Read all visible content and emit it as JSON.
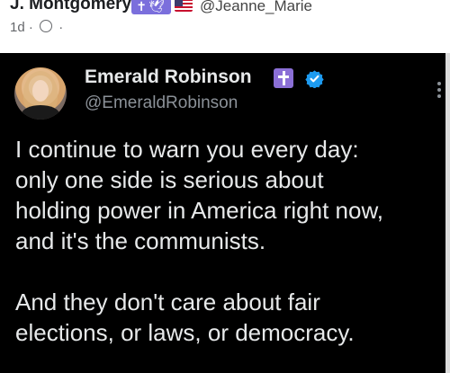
{
  "outer_post": {
    "author_name": "J. Montgomery",
    "badge_text": "✝🕊",
    "handle": "@Jeanne_Marie",
    "meta": "1d ·",
    "meta_trail": "·"
  },
  "tweet": {
    "name": "Emerald Robinson",
    "handle": "@EmeraldRobinson",
    "verified_color": "#1d9bf0",
    "body_lines": [
      "I continue to warn you every day:",
      "only one side is serious about",
      "holding power in America right now,",
      "and it's the communists.",
      "",
      "And they don't care about fair",
      "elections, or laws, or democracy."
    ]
  }
}
